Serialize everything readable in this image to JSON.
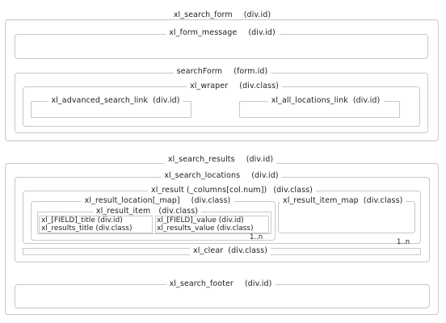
{
  "diagram": {
    "search_form": {
      "name": "xl_search_form",
      "kind": "(div.id)"
    },
    "form_message": {
      "name": "xl_form_message",
      "kind": "(div.id)"
    },
    "search_form_inner": {
      "name": "searchForm",
      "kind": "(form.id)"
    },
    "wraper": {
      "name": "xl_wraper",
      "kind": "(div.class)"
    },
    "advanced_search_link": {
      "name": "xl_advanced_search_link",
      "kind": "(div.id)"
    },
    "all_locations_link": {
      "name": "xl_all_locations_link",
      "kind": "(div.id)"
    },
    "search_results": {
      "name": "xl_search_results",
      "kind": "(div.id)"
    },
    "search_locations": {
      "name": "xl_search_locations",
      "kind": "(div.id)"
    },
    "result": {
      "name": "xl_result (_columns[col.num])",
      "kind": "(div.class)"
    },
    "result_location": {
      "name": "xl_result_location[_map]",
      "kind": "(div.class)"
    },
    "result_item_map": {
      "name": "xl_result_item_map",
      "kind": "(div.class)"
    },
    "result_item": {
      "name": "xl_result_item",
      "kind": "(div.class)"
    },
    "field_title": "xl_[FIELD]_title (div.id)",
    "results_title": "xl_results_title (div.class)",
    "field_value": "xl_[FIELD]_value (div.id)",
    "results_value": "xl_results_value (div.class)",
    "item_multiplicity": "1..n",
    "location_multiplicity": "1..n",
    "clear": {
      "name": "xl_clear",
      "kind": "(div.class)"
    },
    "search_footer": {
      "name": "xl_search_footer",
      "kind": "(div.id)"
    }
  }
}
